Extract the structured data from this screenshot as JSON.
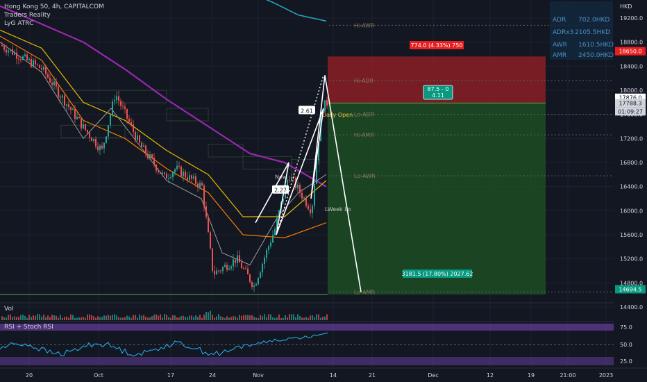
{
  "legend": {
    "symbol": "Hong Kong 50, 4h, CAPITALCOM",
    "indicator1": "Traders Reality",
    "indicator2": "LyG ATRC"
  },
  "currency": "HKD",
  "stats": [
    {
      "label": "ADR",
      "value": "702.0HKD"
    },
    {
      "label": "ADRx3",
      "value": "2105.5HKD"
    },
    {
      "label": "AWR",
      "value": "1610.5HKD"
    },
    {
      "label": "AMR",
      "value": "2450.0HKD"
    }
  ],
  "level_labels": {
    "hi_awr": "Hi-AWR",
    "hi_adr": "Hi-ADR",
    "lo_adr": "Lo-ADR",
    "hi_amr": "Hi-AMR",
    "lo_awr": "Lo-AWR",
    "lo_amr": "Lo-AMR",
    "daily_open": "Daily Open",
    "week_lo": "LWeek Lo",
    "new": "New"
  },
  "position": {
    "risk_label": "774.0 (4.33%) 750",
    "ratio_label": "87.5 - 0",
    "ratio_value": "4.11",
    "reward_label": "3181.5 (17.80%) 2027.62",
    "entry": 17788.5,
    "stop": 18562,
    "target": 14607
  },
  "wave_labels": [
    "2.27",
    "2.61"
  ],
  "price_tags": [
    {
      "text": "18650.0",
      "price": 18650,
      "bg": "#e91e1e",
      "fg": "#ffffff"
    },
    {
      "text": "17876.0",
      "price": 17876,
      "bg": "#ffffff",
      "fg": "#131722"
    },
    {
      "text": "17788.3",
      "price": 17788,
      "bg": "#d1d4dc",
      "fg": "#131722"
    },
    {
      "text": "01:09:27",
      "price": 17650,
      "bg": "#d1d4dc",
      "fg": "#131722"
    },
    {
      "text": "14694.5",
      "price": 14694.5,
      "bg": "#089981",
      "fg": "#ffffff"
    }
  ],
  "panes": {
    "volume_label": "Vol",
    "rsi_label": "RSI + Stoch RSI"
  },
  "colors": {
    "background": "#131722",
    "up": "#26a69a",
    "down": "#ef5350",
    "risk_zone": "#8b1e24",
    "reward_zone": "#1d4d22",
    "ma_purple": "#9c27b0",
    "ma_cyan": "#26a9c0",
    "rsi_line": "#29a6df",
    "rsi_band": "#5e3a8f",
    "text": "#d1d4dc",
    "grid": "#1e2230"
  },
  "chart_data": {
    "type": "candlestick",
    "title": "Hong Kong 50, 4h, CAPITALCOM",
    "y_axis": {
      "unit": "HKD",
      "range": [
        14200,
        19500
      ],
      "ticks": [
        19200,
        18800,
        18400,
        18000,
        17600,
        17200,
        16800,
        16400,
        16000,
        15600,
        15200,
        14800,
        14400
      ]
    },
    "x_axis": {
      "ticks": [
        "20",
        "Oct",
        "17",
        "24",
        "Nov",
        "14",
        "21",
        "Dec",
        "12",
        "19",
        "21:00",
        "2023"
      ]
    },
    "price_path": [
      {
        "x": "20",
        "price": 18750
      },
      {
        "x": "Sep 26",
        "price": 17400
      },
      {
        "x": "Sep 30",
        "price": 17000
      },
      {
        "x": "Oct 5",
        "price": 17950
      },
      {
        "x": "Oct 12",
        "price": 16550
      },
      {
        "x": "17",
        "price": 16700
      },
      {
        "x": "24",
        "price": 14950
      },
      {
        "x": "Oct 31",
        "price": 14750
      },
      {
        "x": "Nov 4",
        "price": 16600
      },
      {
        "x": "Nov 9",
        "price": 16000
      },
      {
        "x": "Nov 11",
        "price": 17700
      },
      {
        "x": "Nov 12",
        "price": 17790
      }
    ],
    "moving_averages": [
      {
        "name": "purple",
        "values": [
          19400,
          19100,
          18800,
          18350,
          17850,
          17400,
          16950,
          16800,
          16400
        ]
      },
      {
        "name": "cyan",
        "values": [
          19650,
          19450,
          19250,
          19150
        ]
      }
    ],
    "wave_path": [
      15800,
      16800,
      15600,
      17700,
      16200,
      18250,
      14650
    ],
    "position": {
      "entry": 17788.5,
      "stop": 18562,
      "target": 14607
    },
    "rsi": {
      "range": [
        0,
        100
      ],
      "ticks": [
        75.0,
        50.0,
        25.0
      ],
      "last": 75
    }
  }
}
